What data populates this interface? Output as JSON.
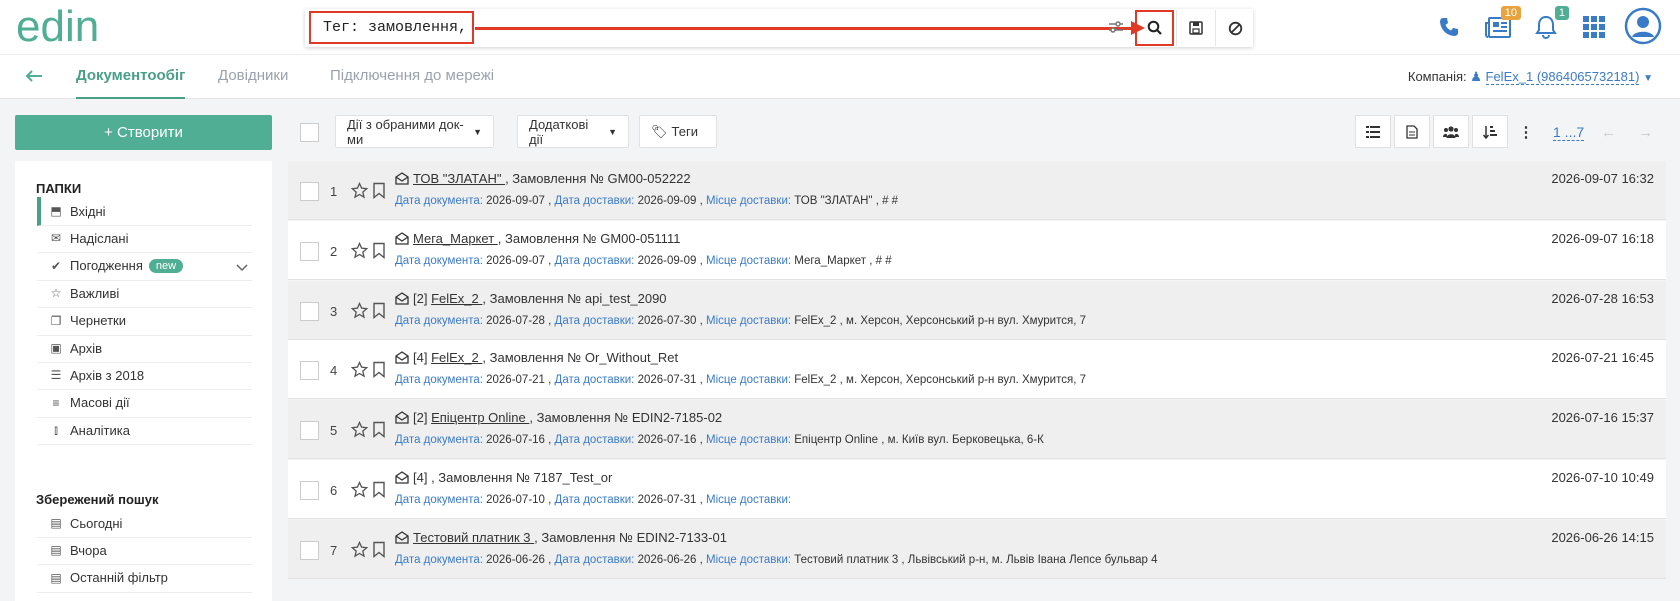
{
  "logo": {
    "text": "edin"
  },
  "search": {
    "value": "Тег: замовлення,"
  },
  "header": {
    "news_badge": "10",
    "notif_badge": "1",
    "colors": {
      "accent": "#4fae93",
      "highlight": "#e03a26",
      "news_badge": "#e8a33c",
      "notif_badge": "#4fae93"
    }
  },
  "nav": {
    "back_icon": "arrow-left-icon",
    "tabs": [
      "Документообіг",
      "Довідники",
      "Підключення до мережі"
    ],
    "company_label": "Компанія:",
    "company_value": "FelEx_1 (9864065732181)"
  },
  "sidebar": {
    "create_label": "+ Створити",
    "folders_title": "ПАПКИ",
    "folders": [
      {
        "label": "Вхідні",
        "icon": "inbox-icon"
      },
      {
        "label": "Надіслані",
        "icon": "envelope-icon"
      },
      {
        "label": "Погодження",
        "icon": "check-icon",
        "badge": "new"
      },
      {
        "label": "Важливі",
        "icon": "star-icon"
      },
      {
        "label": "Чернетки",
        "icon": "file-icon"
      },
      {
        "label": "Архів",
        "icon": "archive-icon"
      },
      {
        "label": "Архів з 2018",
        "icon": "file-text-icon"
      },
      {
        "label": "Масові дії",
        "icon": "list-icon"
      },
      {
        "label": "Аналітика",
        "icon": "bar-chart-icon"
      }
    ],
    "saved_title": "Збережений пошук",
    "saved": [
      {
        "label": "Сьогодні",
        "icon": "dollar-file-icon"
      },
      {
        "label": "Вчора",
        "icon": "dollar-file-icon"
      },
      {
        "label": "Останній фільтр",
        "icon": "dollar-file-icon"
      }
    ]
  },
  "toolbar": {
    "actions_label": "Дії з обраними док-ми",
    "extra_label": "Додаткові дії",
    "tags_label": "Теги",
    "pager": "1 ...7"
  },
  "documents": [
    {
      "num": "1",
      "prefix": "",
      "org": "ТОВ \"ЗЛАТАН\"",
      "title": "Замовлення № GM00-052222",
      "doc_date": "2026-09-07",
      "delivery_date": "2026-09-09",
      "place": "ТОВ \"ЗЛАТАН\" , # #",
      "datetime": "2026-09-07 16:32"
    },
    {
      "num": "2",
      "prefix": "",
      "org": "Мега_Маркет",
      "title": "Замовлення № GM00-051111",
      "doc_date": "2026-09-07",
      "delivery_date": "2026-09-09",
      "place": "Мега_Маркет , # #",
      "datetime": "2026-09-07 16:18"
    },
    {
      "num": "3",
      "prefix": "[2]",
      "org": "FelEx_2",
      "title": "Замовлення № api_test_2090",
      "doc_date": "2026-07-28",
      "delivery_date": "2026-07-30",
      "place": "FelEx_2 , м. Херсон, Херсонський р-н вул. Хмурится, 7",
      "datetime": "2026-07-28 16:53"
    },
    {
      "num": "4",
      "prefix": "[4]",
      "org": "FelEx_2",
      "title": "Замовлення № Or_Without_Ret",
      "doc_date": "2026-07-21",
      "delivery_date": "2026-07-31",
      "place": "FelEx_2 , м. Херсон, Херсонський р-н вул. Хмурится, 7",
      "datetime": "2026-07-21 16:45"
    },
    {
      "num": "5",
      "prefix": "[2]",
      "org": "Епіцентр Online",
      "title": "Замовлення № EDIN2-7185-02",
      "doc_date": "2026-07-16",
      "delivery_date": "2026-07-16",
      "place": "Епіцентр Online , м. Київ вул. Берковецька, 6-К",
      "datetime": "2026-07-16 15:37"
    },
    {
      "num": "6",
      "prefix": "[4]",
      "org": "",
      "title": "Замовлення № 7187_Test_or",
      "doc_date": "2026-07-10",
      "delivery_date": "2026-07-31",
      "place": "",
      "datetime": "2026-07-10 10:49"
    },
    {
      "num": "7",
      "prefix": "",
      "org": "Тестовий платник 3",
      "title": "Замовлення № EDIN2-7133-01",
      "doc_date": "2026-06-26",
      "delivery_date": "2026-06-26",
      "place": "Тестовий платник 3 , Львівський р-н, м. Львів Івана Лепсе бульвар 4",
      "datetime": "2026-06-26 14:15"
    }
  ],
  "doc_labels": {
    "doc_date": "Дата документа:",
    "delivery_date": "Дата доставки:",
    "place": "Місце доставки:"
  }
}
